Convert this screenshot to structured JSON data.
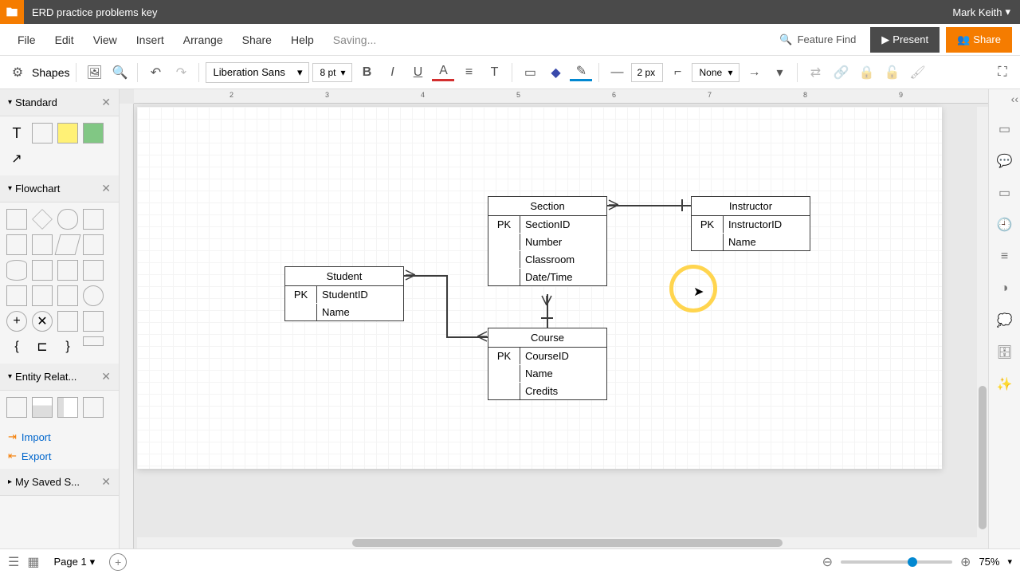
{
  "app": {
    "doc_title": "ERD practice problems key",
    "user": "Mark Keith"
  },
  "menu": {
    "items": [
      "File",
      "Edit",
      "View",
      "Insert",
      "Arrange",
      "Share",
      "Help"
    ],
    "status": "Saving...",
    "feature_find": "Feature Find",
    "present": "Present",
    "share": "Share"
  },
  "toolbar": {
    "shapes": "Shapes",
    "font": "Liberation Sans",
    "font_size": "8 pt",
    "line_width": "2 px",
    "line_style": "None"
  },
  "panels": {
    "standard": "Standard",
    "flowchart": "Flowchart",
    "er": "Entity Relat...",
    "saved": "My Saved S...",
    "import": "Import",
    "export": "Export"
  },
  "entities": {
    "student": {
      "title": "Student",
      "pk": "PK",
      "pk_attr": "StudentID",
      "attrs": [
        "Name"
      ]
    },
    "section": {
      "title": "Section",
      "pk": "PK",
      "pk_attr": "SectionID",
      "attrs": [
        "Number",
        "Classroom",
        "Date/Time"
      ]
    },
    "instructor": {
      "title": "Instructor",
      "pk": "PK",
      "pk_attr": "InstructorID",
      "attrs": [
        "Name"
      ]
    },
    "course": {
      "title": "Course",
      "pk": "PK",
      "pk_attr": "CourseID",
      "attrs": [
        "Name",
        "Credits"
      ]
    }
  },
  "status": {
    "page": "Page 1",
    "zoom": "75%"
  }
}
